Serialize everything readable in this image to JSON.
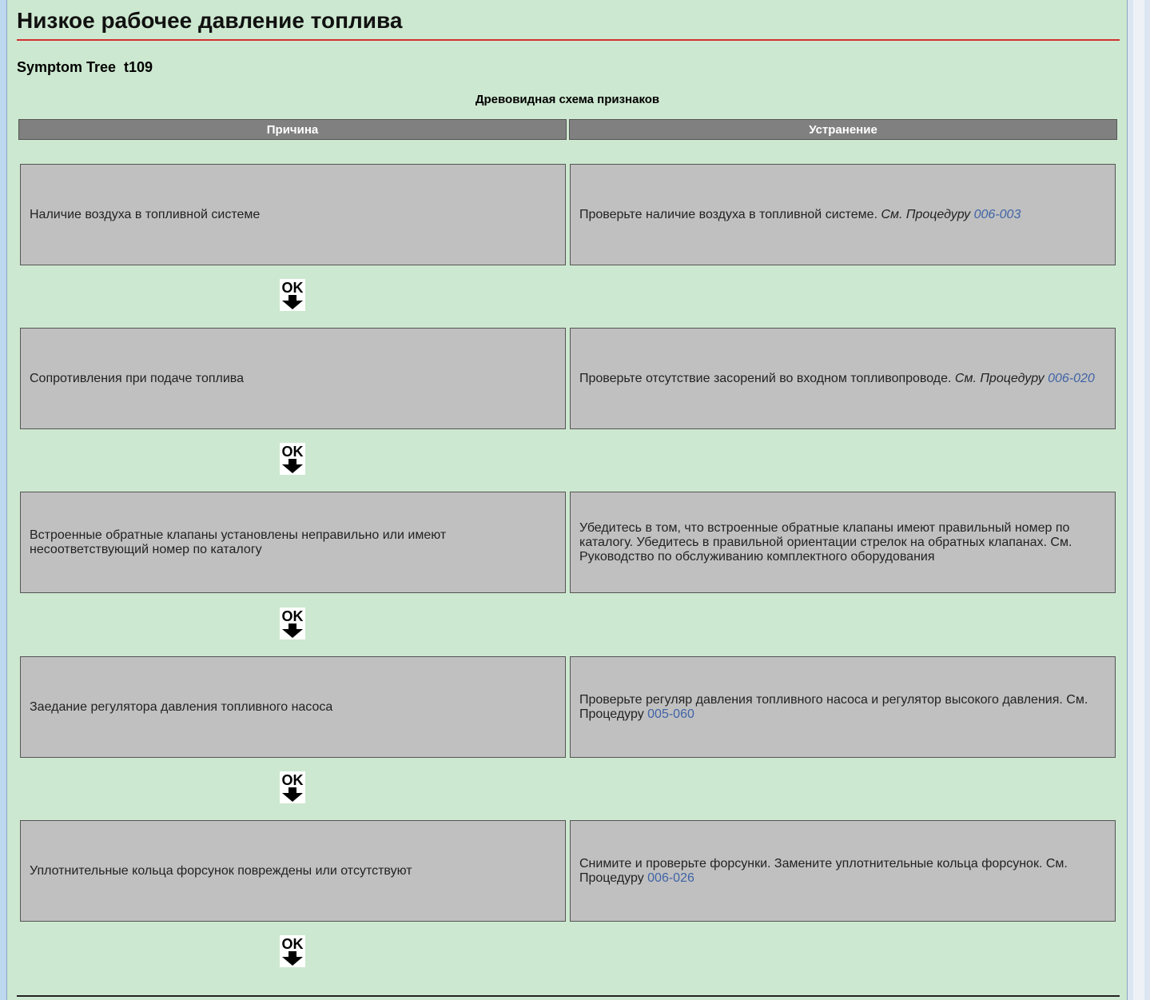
{
  "page": {
    "title": "Низкое рабочее давление топлива",
    "subtitle": "Symptom Tree  t109",
    "caption": "Древовидная схема признаков"
  },
  "table": {
    "header_cause": "Причина",
    "header_fix": "Устранение"
  },
  "rows": [
    {
      "cause": "Наличие воздуха в топливной системе",
      "fix_text": "Проверьте наличие воздуха в топливной системе. ",
      "fix_ref": "См. Процедуру ",
      "fix_link": "006-003"
    },
    {
      "cause": "Сопротивления при подаче топлива",
      "fix_text": "Проверьте отсутствие засорений во входном топливопроводе. ",
      "fix_ref": "См. Процедуру ",
      "fix_link": "006-020"
    },
    {
      "cause": "Встроенные обратные клапаны установлены неправильно или имеют несоответствующий номер по каталогу",
      "fix_text": "Убедитесь в том, что встроенные обратные клапаны имеют правильный номер по каталогу. Убедитесь в правильной ориентации стрелок на обратных клапанах. См. Руководство по обслуживанию комплектного оборудования",
      "fix_ref": "",
      "fix_link": ""
    },
    {
      "cause": "Заедание регулятора давления топливного насоса",
      "fix_text": "Проверьте регуляр давления топливного насоса и регулятор высокого давления. См. Процедуру ",
      "fix_ref": "",
      "fix_link": "005-060"
    },
    {
      "cause": "Уплотнительные кольца форсунок повреждены или отсутствуют",
      "fix_text": "Снимите и проверьте форсунки. Замените уплотнительные кольца форсунок. См. Процедуру ",
      "fix_ref": "",
      "fix_link": "006-026"
    }
  ],
  "ok_label": "OK",
  "icons": {
    "ok_arrow": "ok-down-arrow-icon"
  },
  "colors": {
    "background": "#cde8d0",
    "header": "#808080",
    "cell": "#c0c0c0",
    "link": "#3f63a6",
    "title_rule": "#d03030"
  }
}
